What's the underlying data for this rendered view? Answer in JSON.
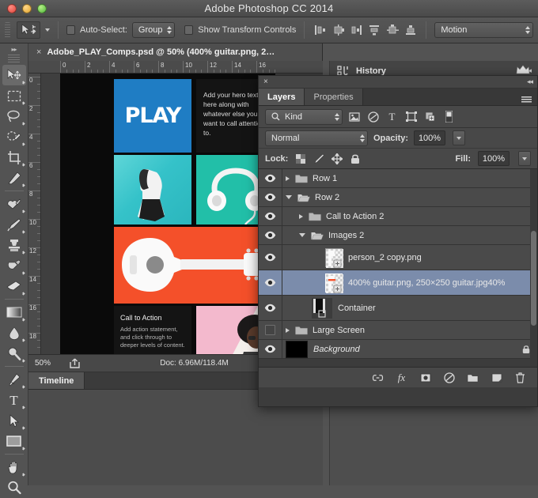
{
  "window": {
    "title": "Adobe Photoshop CC 2014",
    "traffic_lights": [
      "close-button",
      "minimize-button",
      "zoom-button"
    ]
  },
  "options_bar": {
    "tool_icon": "move-tool-icon",
    "auto_select_label": "Auto-Select:",
    "auto_select_value": "Group",
    "show_transform_label": "Show Transform Controls",
    "align_icons": [
      "align-left-edges-icon",
      "align-horizontal-centers-icon",
      "align-right-edges-icon",
      "align-top-edges-icon",
      "align-vertical-centers-icon",
      "align-bottom-edges-icon"
    ],
    "workspace_value": "Motion"
  },
  "document_tab": {
    "label": "Adobe_PLAY_Comps.psd @ 50% (400% guitar.png, 2…",
    "close": "×"
  },
  "toolbar": {
    "tools": [
      {
        "name": "move-tool",
        "active": true
      },
      {
        "name": "rectangular-marquee-tool",
        "active": false
      },
      {
        "name": "lasso-tool",
        "active": false
      },
      {
        "name": "quick-selection-tool",
        "active": false
      },
      {
        "name": "crop-tool",
        "active": false
      },
      {
        "name": "eyedropper-tool",
        "active": false
      },
      {
        "name": "healing-brush-tool",
        "active": false
      },
      {
        "name": "brush-tool",
        "active": false
      },
      {
        "name": "clone-stamp-tool",
        "active": false
      },
      {
        "name": "history-brush-tool",
        "active": false
      },
      {
        "name": "eraser-tool",
        "active": false
      },
      {
        "name": "gradient-tool",
        "active": false
      },
      {
        "name": "blur-tool",
        "active": false
      },
      {
        "name": "dodge-tool",
        "active": false
      },
      {
        "name": "pen-tool",
        "active": false
      },
      {
        "name": "type-tool",
        "active": false
      },
      {
        "name": "path-selection-tool",
        "active": false
      },
      {
        "name": "rectangle-tool",
        "active": false
      },
      {
        "name": "hand-tool",
        "active": false
      },
      {
        "name": "zoom-tool",
        "active": false
      }
    ],
    "type_tool_glyph": "T"
  },
  "rulers": {
    "horizontal_ticks": [
      "0",
      "2",
      "4",
      "6",
      "8",
      "10",
      "12",
      "14",
      "16"
    ],
    "vertical_ticks": [
      "0",
      "2",
      "4",
      "6",
      "8",
      "10",
      "12",
      "14",
      "16",
      "18"
    ]
  },
  "canvas": {
    "tiles": {
      "play_word": "PLAY",
      "play_color": "#1f7dc4",
      "hero_text": "Add your hero text here along with whatever else you want to call attention to.",
      "person_color": "#35c2c9",
      "headphones_color": "#22bfa8",
      "guitar_color": "#f4502a",
      "cta_title": "Call to Action",
      "cta_body": "Add action statement, and click through to deeper levels of content.",
      "portrait_color": "#f3b9cd"
    }
  },
  "status_bar": {
    "zoom": "50%",
    "share_icon": "share-icon",
    "doc_info": "Doc: 6.96M/118.4M",
    "play_icon": "play-arrow-icon"
  },
  "timeline": {
    "tab_label": "Timeline"
  },
  "history_panel": {
    "icon": "history-icon",
    "title": "History",
    "collapse_icon": "collapse-double-arrow-icon",
    "crown_icon": "crown-icon"
  },
  "layers_panel": {
    "close_icon": "×",
    "collapse_icon": "collapse-double-arrow-icon",
    "tabs": [
      {
        "label": "Layers",
        "active": true
      },
      {
        "label": "Properties",
        "active": false
      }
    ],
    "menu_icon": "panel-menu-icon",
    "filter": {
      "search_icon": "search-icon",
      "kind_value": "Kind",
      "icons": [
        "filter-pixel-layers-icon",
        "filter-adjustment-layers-icon",
        "filter-type-layers-icon",
        "filter-shape-layers-icon",
        "filter-smart-object-icon"
      ],
      "toggle": "filter-toggle-switch"
    },
    "blend": {
      "mode": "Normal",
      "opacity_label": "Opacity:",
      "opacity_value": "100%"
    },
    "lock": {
      "label": "Lock:",
      "icons": [
        "lock-transparent-pixels-icon",
        "lock-image-pixels-icon",
        "lock-position-icon",
        "lock-all-icon"
      ],
      "fill_label": "Fill:",
      "fill_value": "100%"
    },
    "layers": [
      {
        "name": "Row 1",
        "visible": true,
        "type": "group",
        "expanded": false,
        "indent": 0,
        "selected": false,
        "locked": false
      },
      {
        "name": "Row 2",
        "visible": true,
        "type": "group",
        "expanded": true,
        "indent": 0,
        "selected": false,
        "locked": false
      },
      {
        "name": "Call to Action 2",
        "visible": true,
        "type": "group",
        "expanded": false,
        "indent": 1,
        "selected": false,
        "locked": false
      },
      {
        "name": "Images 2",
        "visible": true,
        "type": "group",
        "expanded": true,
        "indent": 1,
        "selected": false,
        "locked": false
      },
      {
        "name": "person_2 copy.png",
        "visible": true,
        "type": "smart-object",
        "indent": 2,
        "selected": false,
        "locked": false
      },
      {
        "name": "400% guitar.png, 250×250 guitar.jpg40%",
        "visible": true,
        "type": "smart-object",
        "indent": 2,
        "selected": true,
        "locked": false
      },
      {
        "name": "Container",
        "visible": true,
        "type": "pixel",
        "indent": 1,
        "selected": false,
        "locked": false
      },
      {
        "name": "Large Screen",
        "visible": false,
        "type": "group",
        "expanded": false,
        "indent": 0,
        "selected": false,
        "locked": false
      },
      {
        "name": "Background",
        "visible": true,
        "type": "background",
        "indent": 0,
        "selected": false,
        "locked": true
      }
    ],
    "bottom_icons": [
      "link-layers-icon",
      "layer-style-fx-icon",
      "add-layer-mask-icon",
      "new-adjustment-layer-icon",
      "new-group-icon",
      "new-layer-icon",
      "delete-layer-icon"
    ]
  }
}
